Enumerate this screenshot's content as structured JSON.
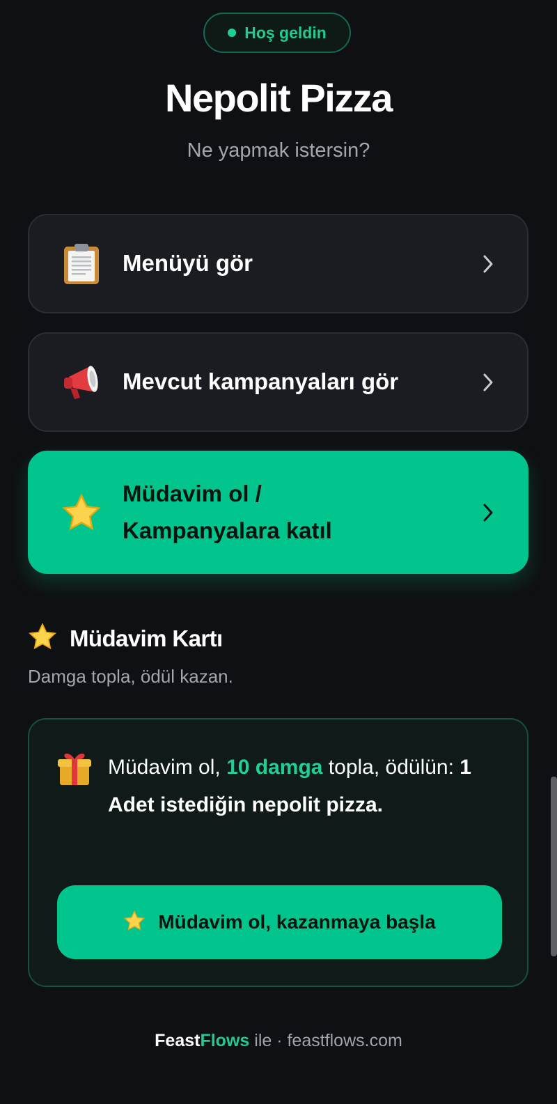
{
  "header": {
    "badge": "Hoş geldin",
    "title": "Nepolit Pizza",
    "subtitle": "Ne yapmak istersin?"
  },
  "actions": [
    {
      "label": "Menüyü gör",
      "icon": "clipboard-icon"
    },
    {
      "label": "Mevcut kampanyaları gör",
      "icon": "megaphone-icon"
    },
    {
      "label_line1": "Müdavim ol /",
      "label_line2": "Kampanyalara katıl",
      "icon": "star-icon"
    }
  ],
  "loyalty": {
    "title": "Müdavim Kartı",
    "subtitle": "Damga topla, ödül kazan.",
    "text_part1": "Müdavim ol, ",
    "stamps": "10 damga",
    "text_part2": " topla, ödülün: ",
    "reward": "1 Adet istediğin nepolit pizza.",
    "cta": "Müdavim ol, kazanmaya başla"
  },
  "footer": {
    "brand_part1": "Feast",
    "brand_part2": "Flows",
    "suffix": " ile · feastflows.com"
  },
  "colors": {
    "accent": "#02c58d",
    "background": "#0f1013",
    "card": "#1a1c22"
  }
}
